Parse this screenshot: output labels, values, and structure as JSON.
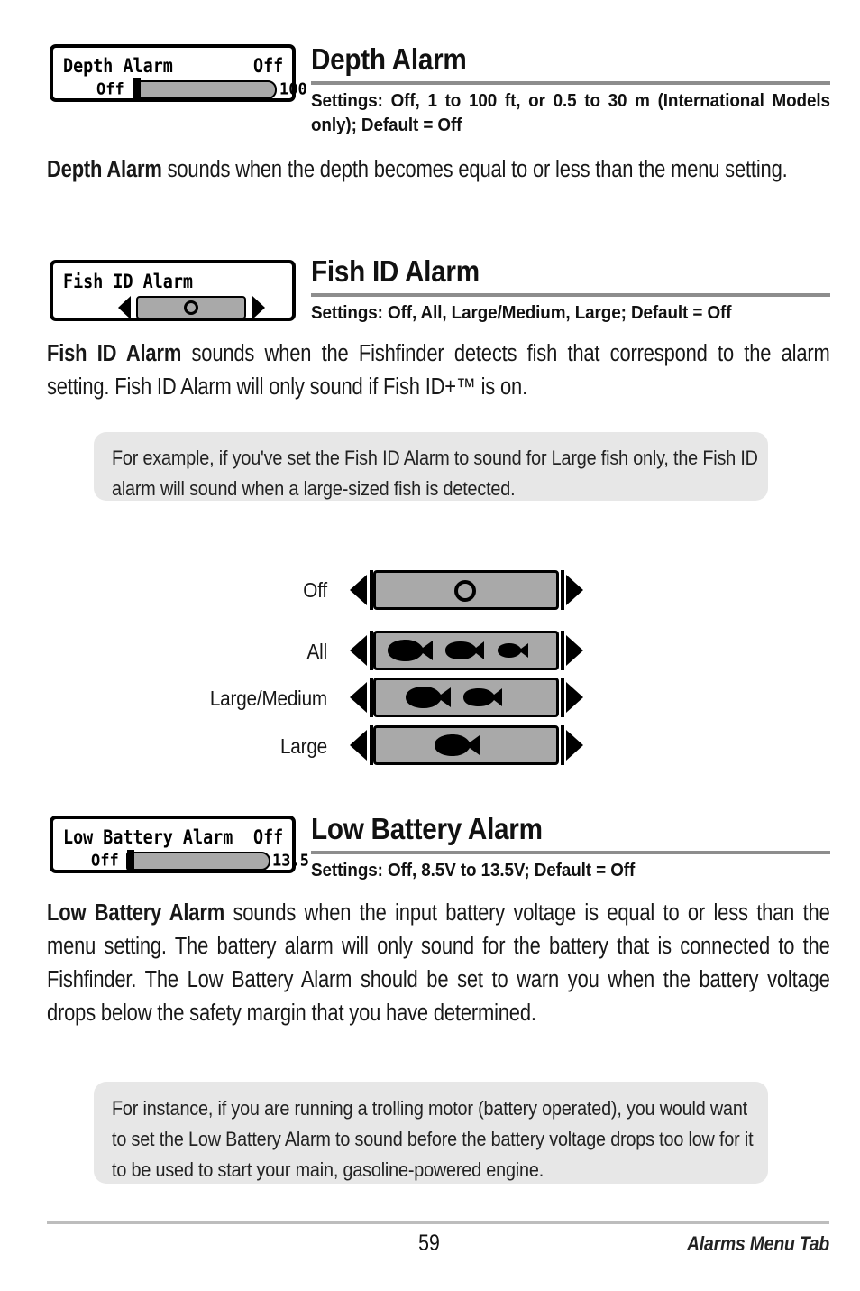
{
  "page": {
    "number": "59",
    "footer_right": "Alarms Menu Tab"
  },
  "sections": [
    {
      "id": "depth-alarm",
      "heading": "Depth Alarm",
      "settings": "Settings: Off, 1 to 100 ft, or 0.5 to 30 m (International Models only); Default = Off",
      "widget": {
        "type": "slider-menu",
        "title": "Depth Alarm",
        "value": "Off",
        "min_label": "Off",
        "max_label": "100"
      },
      "paragraph_bold": "Depth Alarm",
      "paragraph_rest": " sounds when the depth becomes equal to or less than the menu setting."
    },
    {
      "id": "fish-id-alarm",
      "heading": "Fish ID Alarm",
      "settings": "Settings: Off, All, Large/Medium, Large; Default = Off",
      "widget": {
        "type": "choice-menu",
        "title": "Fish ID Alarm",
        "selected": "Off"
      },
      "paragraph_bold": "Fish ID Alarm",
      "paragraph_rest": " sounds when the Fishfinder detects fish that correspond to the alarm setting. Fish ID Alarm will only sound if Fish ID+™ is on.",
      "callout": "For example, if you've set the Fish ID Alarm to sound for Large fish only, the Fish ID alarm will sound when a large-sized fish is detected."
    },
    {
      "id": "low-battery-alarm",
      "heading": "Low Battery Alarm",
      "settings": "Settings: Off, 8.5V to 13.5V; Default = Off",
      "widget": {
        "type": "slider-menu",
        "title": "Low Battery Alarm",
        "value": "Off",
        "min_label": "Off",
        "max_label": "13.5"
      },
      "paragraph_bold": "Low Battery Alarm",
      "paragraph_rest": " sounds when the input battery voltage is equal to or less than the menu setting. The battery alarm will only sound for the battery that is connected to the Fishfinder. The Low Battery Alarm should be set to warn you when the battery voltage drops below the safety margin that you have determined.",
      "callout": "For instance, if you are running a trolling motor (battery operated), you would want to set the Low Battery Alarm to sound before the battery voltage drops too low for it to be used to start your main, gasoline-powered engine."
    }
  ],
  "fish_id_options": [
    {
      "label": "Off",
      "glyph": "circle",
      "fish_count": 0
    },
    {
      "label": "All",
      "glyph": "fish",
      "fish_count": 3
    },
    {
      "label": "Large/Medium",
      "glyph": "fish",
      "fish_count": 2
    },
    {
      "label": "Large",
      "glyph": "fish",
      "fish_count": 1
    }
  ],
  "colors": {
    "lcd_gray": "#a9a9a9",
    "callout_gray": "#e7e7e7",
    "rule_gray": "#8d8d8d",
    "footer_rule_gray": "#bdbdbd",
    "text": "#181818"
  }
}
